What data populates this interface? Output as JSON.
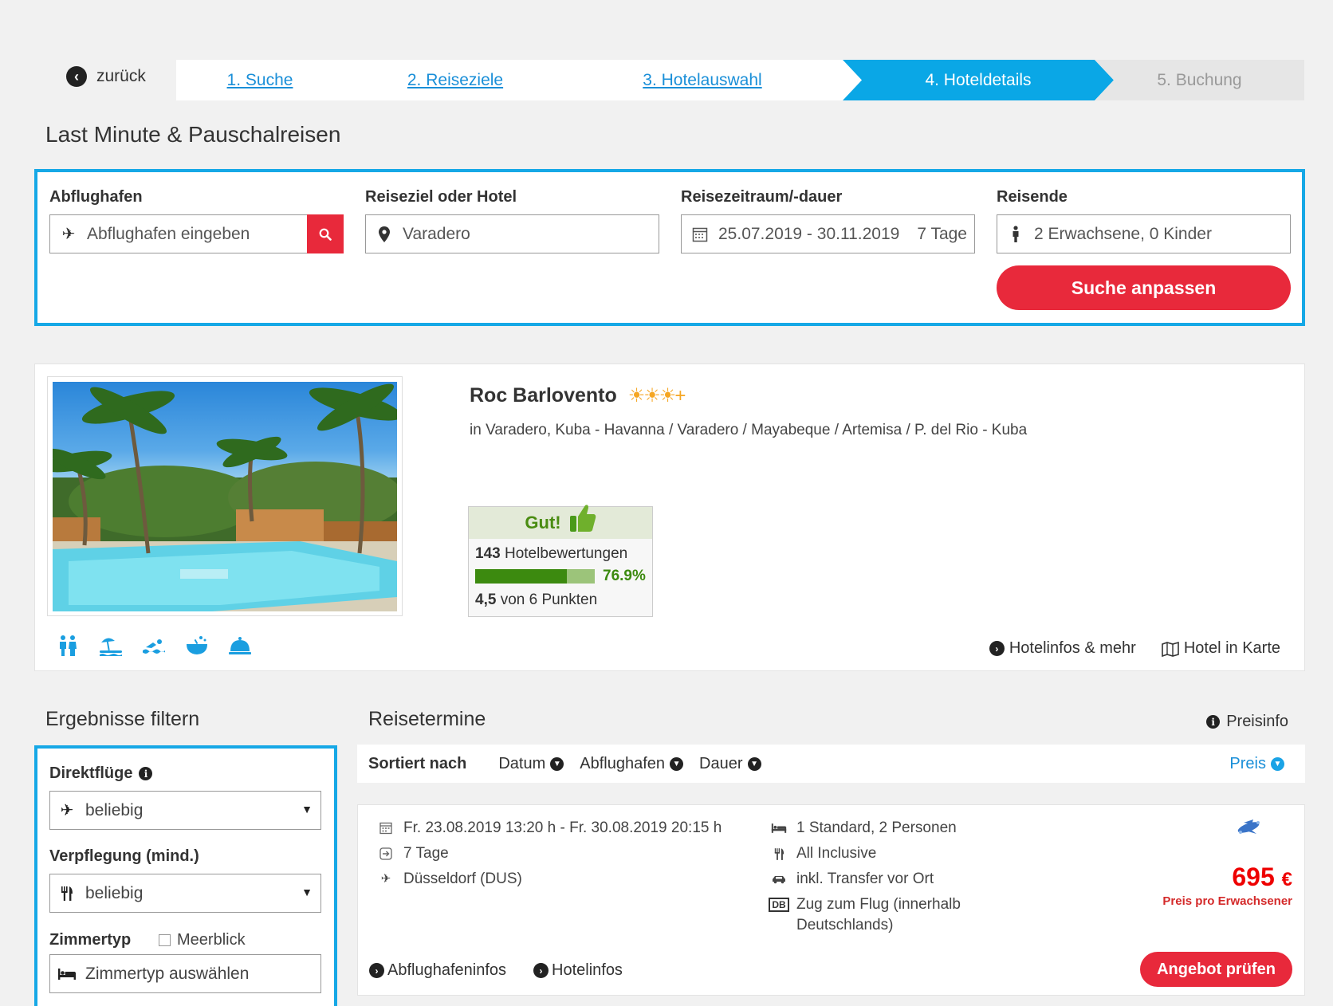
{
  "nav": {
    "back_label": "zurück",
    "steps": [
      {
        "label": "1. Suche",
        "state": "link"
      },
      {
        "label": "2. Reiseziele",
        "state": "link"
      },
      {
        "label": "3. Hotelauswahl",
        "state": "link"
      },
      {
        "label": "4. Hoteldetails",
        "state": "active"
      },
      {
        "label": "5. Buchung",
        "state": "disabled"
      }
    ]
  },
  "page_title": "Last Minute & Pauschalreisen",
  "search": {
    "airport": {
      "label": "Abflughafen",
      "placeholder": "Abflughafen eingeben",
      "icon": "plane-icon",
      "button_icon": "search-icon"
    },
    "destination": {
      "label": "Reiseziel oder Hotel",
      "value": "Varadero",
      "icon": "map-pin-icon"
    },
    "period": {
      "label": "Reisezeitraum/-dauer",
      "dates": "25.07.2019 - 30.11.2019",
      "duration": "7 Tage",
      "icon": "calendar-icon"
    },
    "travelers": {
      "label": "Reisende",
      "value": "2 Erwachsene, 0 Kinder",
      "icon": "person-icon"
    },
    "submit_label": "Suche anpassen"
  },
  "hotel": {
    "name": "Roc Barlovento",
    "stars_text": "☀☀☀+",
    "location": "in Varadero, Kuba - Havanna / Varadero / Mayabeque / Artemisa / P. del Rio - Kuba",
    "rating": {
      "verdict": "Gut!",
      "review_count": "143",
      "review_label": "Hotelbewertungen",
      "recommend_percent": "76.9%",
      "recommend_fraction": 0.769,
      "score": "4,5",
      "score_suffix": "von 6 Punkten"
    },
    "amenities": [
      "family-icon",
      "beach-icon",
      "swimming-icon",
      "wellness-icon",
      "service-bell-icon"
    ],
    "links": {
      "info": "Hotelinfos & mehr",
      "map": "Hotel in Karte"
    }
  },
  "filters": {
    "title": "Ergebnisse filtern",
    "direct_flights": {
      "label": "Direktflüge",
      "value": "beliebig"
    },
    "board": {
      "label": "Verpflegung (mind.)",
      "value": "beliebig"
    },
    "room": {
      "label": "Zimmertyp",
      "checkbox_label": "Meerblick",
      "placeholder": "Zimmertyp auswählen"
    }
  },
  "dates": {
    "title": "Reisetermine",
    "price_info": "Preisinfo",
    "sort": {
      "label": "Sortiert nach",
      "options": [
        "Datum",
        "Abflughafen",
        "Dauer"
      ],
      "active": "Preis"
    }
  },
  "offer": {
    "datetime": "Fr. 23.08.2019 13:20 h - Fr. 30.08.2019 20:15 h",
    "duration": "7 Tage",
    "airport": "Düsseldorf (DUS)",
    "room": "1 Standard, 2 Personen",
    "board": "All Inclusive",
    "transfer": "inkl. Transfer vor Ort",
    "train": "Zug zum Flug (innerhalb Deutschlands)",
    "price": "695",
    "currency": "€",
    "price_note": "Preis pro Erwachsener",
    "links": {
      "airport": "Abflughafeninfos",
      "hotel": "Hotelinfos"
    },
    "cta": "Angebot prüfen"
  }
}
